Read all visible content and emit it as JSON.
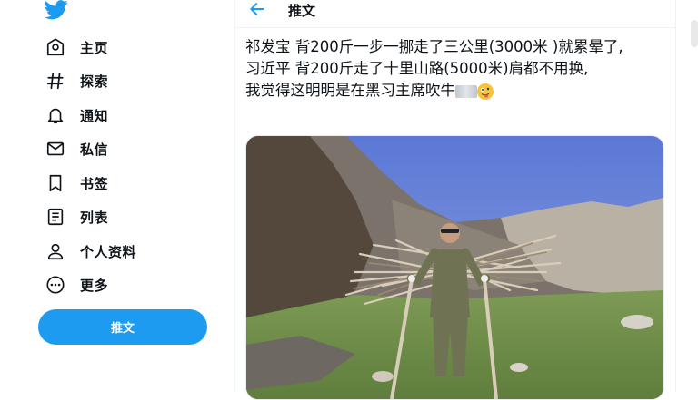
{
  "sidebar": {
    "logo_icon": "twitter-bird-icon",
    "items": [
      {
        "icon": "home-icon",
        "label": "主页"
      },
      {
        "icon": "hashtag-icon",
        "label": "探索"
      },
      {
        "icon": "bell-icon",
        "label": "通知"
      },
      {
        "icon": "mail-icon",
        "label": "私信"
      },
      {
        "icon": "bookmark-icon",
        "label": "书签"
      },
      {
        "icon": "list-icon",
        "label": "列表"
      },
      {
        "icon": "profile-icon",
        "label": "个人资料"
      },
      {
        "icon": "more-icon",
        "label": "更多"
      }
    ],
    "tweet_button": "推文"
  },
  "header": {
    "back_icon": "back-arrow-icon",
    "title": "推文"
  },
  "tweet": {
    "lines": [
      "祁发宝 背200斤一步一挪走了三公里(3000米 )就累晕了,",
      "习近平 背200斤走了十里山路(5000米)肩都不用换,",
      "我觉得这明明是在黑习主席吹牛"
    ],
    "emoji": "crazy-face-emoji",
    "image": "photo-man-carrying-firewood"
  },
  "colors": {
    "brand": "#1d9bf0",
    "text": "#0f1419",
    "divider": "#eff3f4"
  }
}
